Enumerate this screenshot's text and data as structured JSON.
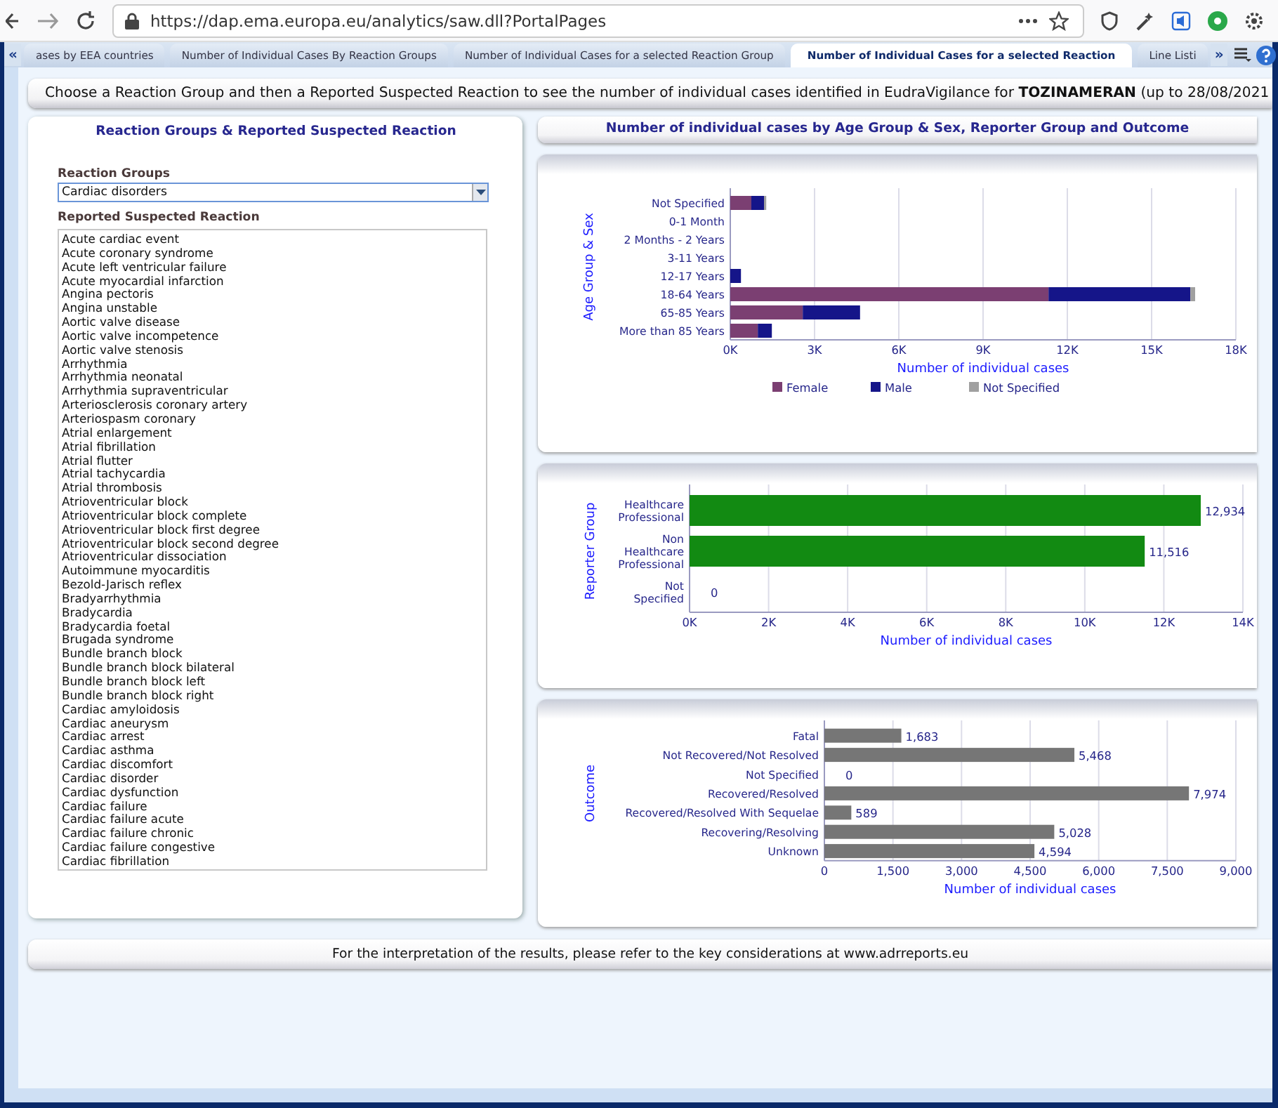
{
  "browser": {
    "url": "https://dap.ema.europa.eu/analytics/saw.dll?PortalPages"
  },
  "tabs": {
    "prev": "«",
    "next": "»",
    "items": [
      {
        "label": "ases by EEA countries",
        "selected": false
      },
      {
        "label": "Number of Individual Cases By Reaction Groups",
        "selected": false
      },
      {
        "label": "Number of Individual Cases for a selected Reaction Group",
        "selected": false
      },
      {
        "label": "Number of Individual Cases for a selected Reaction",
        "selected": true
      },
      {
        "label": "Line Listi",
        "selected": false
      }
    ]
  },
  "banner": "Choose a Reaction Group and then a Reported Suspected Reaction to see the number of individual cases identified in EudraVigilance for **TOZINAMERAN** (up to 28/08/2021",
  "selector_panel": {
    "title": "Reaction Groups & Reported Suspected Reaction",
    "group_label": "Reaction Groups",
    "group_value": "Cardiac disorders",
    "reaction_label": "Reported Suspected Reaction",
    "reactions": [
      {
        "label": "Acute cardiac event",
        "selected": false
      },
      {
        "label": "Acute coronary syndrome",
        "selected": false
      },
      {
        "label": "Acute left ventricular failure",
        "selected": false
      },
      {
        "label": "Acute myocardial infarction",
        "selected": false
      },
      {
        "label": "Angina pectoris",
        "selected": false
      },
      {
        "label": "Angina unstable",
        "selected": false
      },
      {
        "label": "Aortic valve disease",
        "selected": false
      },
      {
        "label": "Aortic valve incompetence",
        "selected": false
      },
      {
        "label": "Aortic valve stenosis",
        "selected": false
      },
      {
        "label": "Arrhythmia",
        "selected": false
      },
      {
        "label": "Arrhythmia neonatal",
        "selected": false
      },
      {
        "label": "Arrhythmia supraventricular",
        "selected": false
      },
      {
        "label": "Arteriosclerosis coronary artery",
        "selected": false
      },
      {
        "label": "Arteriospasm coronary",
        "selected": false
      },
      {
        "label": "Atrial enlargement",
        "selected": false
      },
      {
        "label": "Atrial fibrillation",
        "selected": false
      },
      {
        "label": "Atrial flutter",
        "selected": false
      },
      {
        "label": "Atrial tachycardia",
        "selected": false
      },
      {
        "label": "Atrial thrombosis",
        "selected": false
      },
      {
        "label": "Atrioventricular block",
        "selected": false
      },
      {
        "label": "Atrioventricular block complete",
        "selected": false
      },
      {
        "label": "Atrioventricular block first degree",
        "selected": false
      },
      {
        "label": "Atrioventricular block second degree",
        "selected": false
      },
      {
        "label": "Atrioventricular dissociation",
        "selected": false
      },
      {
        "label": "Autoimmune myocarditis",
        "selected": false
      },
      {
        "label": "Bezold-Jarisch reflex",
        "selected": false
      },
      {
        "label": "Bradyarrhythmia",
        "selected": false
      },
      {
        "label": "Bradycardia",
        "selected": false
      },
      {
        "label": "Bradycardia foetal",
        "selected": false
      },
      {
        "label": "Brugada syndrome",
        "selected": false
      },
      {
        "label": "Bundle branch block",
        "selected": false
      },
      {
        "label": "Bundle branch block bilateral",
        "selected": false
      },
      {
        "label": "Bundle branch block left",
        "selected": false
      },
      {
        "label": "Bundle branch block right",
        "selected": false
      },
      {
        "label": "Cardiac amyloidosis",
        "selected": false
      },
      {
        "label": "Cardiac aneurysm",
        "selected": false
      },
      {
        "label": "Cardiac arrest",
        "selected": false
      },
      {
        "label": "Cardiac asthma",
        "selected": false
      },
      {
        "label": "Cardiac discomfort",
        "selected": false
      },
      {
        "label": "Cardiac disorder",
        "selected": false
      },
      {
        "label": "Cardiac dysfunction",
        "selected": false
      },
      {
        "label": "Cardiac failure",
        "selected": false
      },
      {
        "label": "Cardiac failure acute",
        "selected": false
      },
      {
        "label": "Cardiac failure chronic",
        "selected": false
      },
      {
        "label": "Cardiac failure congestive",
        "selected": false
      },
      {
        "label": "Cardiac fibrillation",
        "selected": false
      }
    ]
  },
  "charts_title": "Number of individual cases by Age Group & Sex, Reporter Group and Outcome",
  "chart_panels": [
    {
      "chart_data": {
        "type": "bar",
        "orientation": "horizontal",
        "stacked": true,
        "grid": true,
        "legend": true,
        "xlabel": "Number of individual cases",
        "ylabel": "Age Group & Sex",
        "categories": [
          "Not Specified",
          "0-1 Month",
          "2 Months - 2 Years",
          "3-11 Years",
          "12-17 Years",
          "18-64 Years",
          "65-85 Years",
          "More than 85 Years"
        ],
        "series": [
          {
            "name": "Female",
            "color": "#7b3f72",
            "values": [
              750,
              0,
              0,
              0,
              0,
              11330,
              2580,
              980
            ]
          },
          {
            "name": "Male",
            "color": "#151589",
            "values": [
              450,
              0,
              0,
              0,
              380,
              5050,
              2040,
              500
            ]
          },
          {
            "name": "Not Specified",
            "color": "#a0a0a0",
            "values": [
              80,
              0,
              0,
              0,
              0,
              170,
              0,
              0
            ]
          }
        ],
        "xlim": [
          0,
          18000
        ],
        "xticks": [
          {
            "value": 0,
            "label": "0K"
          },
          {
            "value": 3000,
            "label": "3K"
          },
          {
            "value": 6000,
            "label": "6K"
          },
          {
            "value": 9000,
            "label": "9K"
          },
          {
            "value": 12000,
            "label": "12K"
          },
          {
            "value": 15000,
            "label": "15K"
          },
          {
            "value": 18000,
            "label": "18K"
          }
        ]
      }
    },
    {
      "chart_data": {
        "type": "bar",
        "orientation": "horizontal",
        "grid": true,
        "xlabel": "Number of individual cases",
        "ylabel": "Reporter Group",
        "categories": [
          "Healthcare Professional",
          "Non Healthcare Professional",
          "Not Specified"
        ],
        "values": [
          12934,
          11516,
          0
        ],
        "value_labels": [
          "12,934",
          "11,516",
          "0"
        ],
        "xlim": [
          0,
          14000
        ],
        "xticks": [
          {
            "value": 0,
            "label": "0K"
          },
          {
            "value": 2000,
            "label": "2K"
          },
          {
            "value": 4000,
            "label": "4K"
          },
          {
            "value": 6000,
            "label": "6K"
          },
          {
            "value": 8000,
            "label": "8K"
          },
          {
            "value": 10000,
            "label": "10K"
          },
          {
            "value": 12000,
            "label": "12K"
          },
          {
            "value": 14000,
            "label": "14K"
          }
        ]
      }
    },
    {
      "chart_data": {
        "type": "bar",
        "orientation": "horizontal",
        "grid": true,
        "xlabel": "Number of individual cases",
        "ylabel": "Outcome",
        "categories": [
          "Fatal",
          "Not Recovered/Not Resolved",
          "Not Specified",
          "Recovered/Resolved",
          "Recovered/Resolved With Sequelae",
          "Recovering/Resolving",
          "Unknown"
        ],
        "values": [
          1683,
          5468,
          0,
          7974,
          589,
          5028,
          4594
        ],
        "value_labels": [
          "1,683",
          "5,468",
          "0",
          "7,974",
          "589",
          "5,028",
          "4,594"
        ],
        "xlim": [
          0,
          9000
        ],
        "xticks": [
          {
            "value": 0,
            "label": "0"
          },
          {
            "value": 1500,
            "label": "1,500"
          },
          {
            "value": 3000,
            "label": "3,000"
          },
          {
            "value": 4500,
            "label": "4,500"
          },
          {
            "value": 6000,
            "label": "6,000"
          },
          {
            "value": 7500,
            "label": "7,500"
          },
          {
            "value": 9000,
            "label": "9,000"
          }
        ]
      }
    }
  ],
  "footer": "For the interpretation of the results, please refer to the key considerations at www.adrreports.eu"
}
